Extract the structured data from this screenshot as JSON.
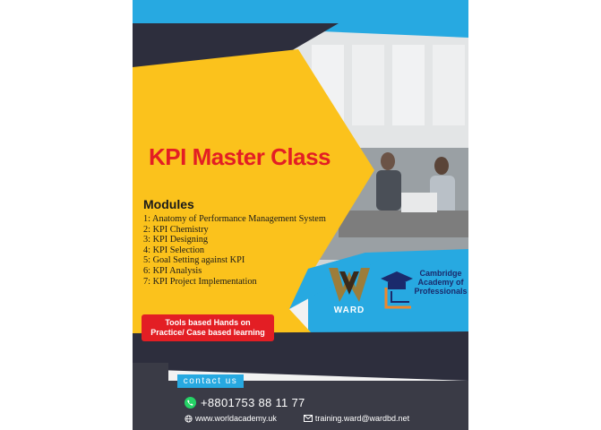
{
  "flyer": {
    "title": "KPI Master Class",
    "modules_heading": "Modules",
    "modules": [
      "1: Anatomy of Performance Management System",
      "2: KPI Chemistry",
      "3: KPI Designing",
      "4: KPI Selection",
      "5: Goal Setting against KPI",
      "6: KPI Analysis",
      "7: KPI Project Implementation"
    ],
    "tools_badge": {
      "line1": "Tools based Hands on",
      "line2": "Practice/ Case based learning"
    },
    "logos": {
      "ward_label": "WARD",
      "cambridge": {
        "line1": "Cambridge",
        "line2": "Academy of",
        "line3": "Professionals"
      }
    },
    "contact": {
      "tab_label": "contact us",
      "phone": "+8801753 88 11 77",
      "website": "www.worldacademy.uk",
      "email": "training.ward@wardbd.net"
    }
  },
  "colors": {
    "title_red": "#e31e24",
    "yellow": "#fbc21c",
    "blue": "#27a9e1",
    "navy": "#2d2e3d",
    "dark_footer": "#3a3b46",
    "whatsapp_green": "#25d366"
  }
}
